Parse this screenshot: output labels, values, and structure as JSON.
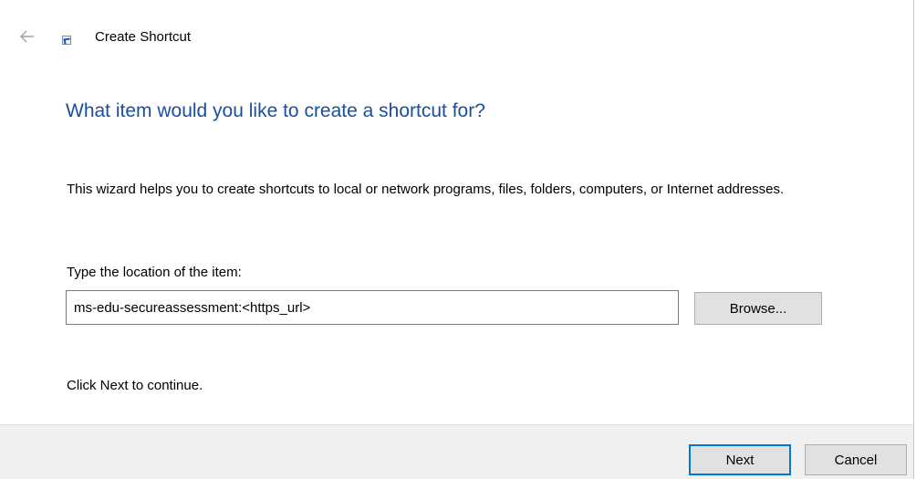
{
  "window": {
    "title": "Create Shortcut",
    "icon": "shortcut-icon",
    "back_icon": "back-arrow-icon"
  },
  "main": {
    "heading": "What item would you like to create a shortcut for?",
    "description": "This wizard helps you to create shortcuts to local or network programs, files, folders, computers, or Internet addresses.",
    "location_label": "Type the location of the item:",
    "location_value": "ms-edu-secureassessment:<https_url>",
    "browse_label": "Browse...",
    "continue_text": "Click Next to continue."
  },
  "footer": {
    "next_label": "Next",
    "cancel_label": "Cancel"
  },
  "colors": {
    "heading": "#1a4fa0",
    "default_button_border": "#0078d7",
    "footer_background": "#f0f0f0"
  }
}
